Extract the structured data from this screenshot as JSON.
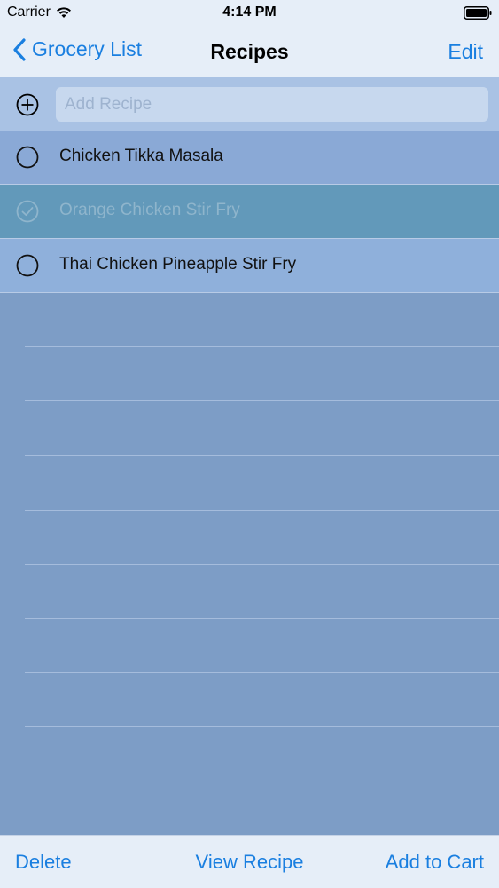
{
  "status_bar": {
    "carrier": "Carrier",
    "time": "4:14 PM",
    "wifi_icon": "wifi-icon",
    "battery_icon": "battery-icon"
  },
  "nav": {
    "back_label": "Grocery List",
    "title": "Recipes",
    "edit_label": "Edit",
    "back_icon": "chevron-left-icon"
  },
  "add_row": {
    "placeholder": "Add Recipe",
    "value": "",
    "icon": "plus-circle-icon"
  },
  "recipes": [
    {
      "name": "Chicken Tikka Masala",
      "checked": false
    },
    {
      "name": "Orange Chicken Stir Fry",
      "checked": true
    },
    {
      "name": "Thai Chicken Pineapple Stir Fry",
      "checked": false
    }
  ],
  "toolbar": {
    "delete_label": "Delete",
    "view_label": "View Recipe",
    "cart_label": "Add to Cart"
  },
  "colors": {
    "accent": "#1a7fe0",
    "bar_background": "#e6eef8",
    "list_background": "#7d9dc6",
    "checked_row": "#6299ba"
  }
}
